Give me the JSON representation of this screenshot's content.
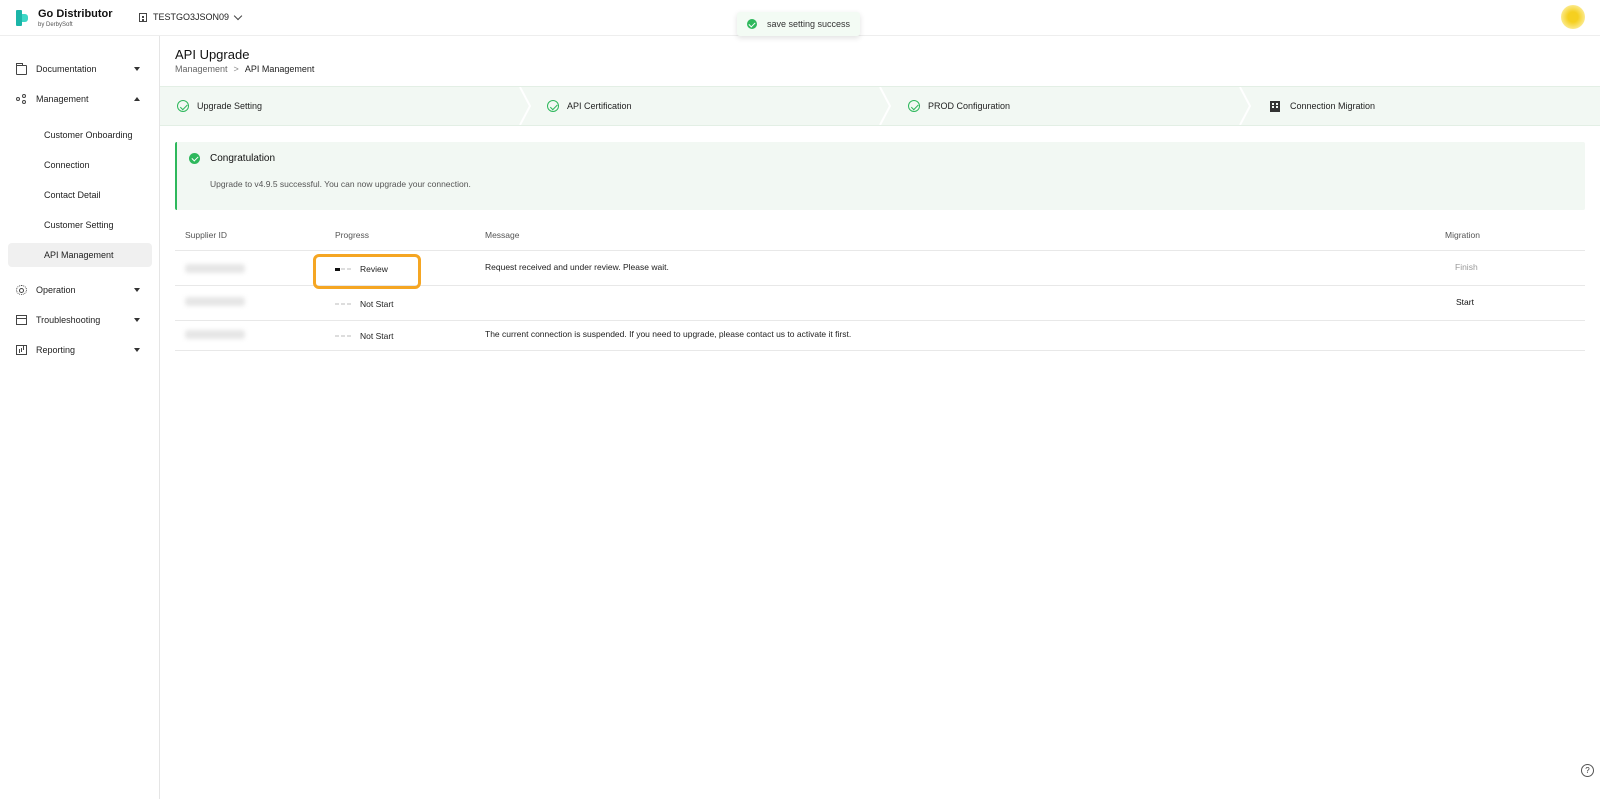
{
  "app": {
    "name": "Go Distributor",
    "by": "by DerbySoft"
  },
  "tenant": {
    "label": "TESTGO3JSON09"
  },
  "toast": {
    "message": "save setting success"
  },
  "sidebar": {
    "items": [
      {
        "label": "Documentation",
        "icon": "folder-icon"
      },
      {
        "label": "Management",
        "icon": "share-icon"
      },
      {
        "label": "Operation",
        "icon": "gear-icon"
      },
      {
        "label": "Troubleshooting",
        "icon": "calendar-icon"
      },
      {
        "label": "Reporting",
        "icon": "report-icon"
      }
    ],
    "sub_items": [
      "Customer Onboarding",
      "Connection",
      "Contact Detail",
      "Customer Setting",
      "API Management"
    ],
    "active": "API Management"
  },
  "page": {
    "title": "API Upgrade",
    "breadcrumb": [
      "Management",
      ">",
      "API Management"
    ]
  },
  "steps": [
    {
      "label": "Upgrade Setting",
      "status": "done"
    },
    {
      "label": "API Certification",
      "status": "done"
    },
    {
      "label": "PROD Configuration",
      "status": "done"
    },
    {
      "label": "Connection Migration",
      "status": "current"
    }
  ],
  "alert": {
    "title": "Congratulation",
    "message": "Upgrade to v4.9.5 successful. You can now upgrade your connection."
  },
  "table": {
    "columns": [
      "Supplier ID",
      "Progress",
      "Message",
      "Migration"
    ],
    "rows": [
      {
        "progress": "Review",
        "message": "Request received and under review. Please wait.",
        "migration": "Finish"
      },
      {
        "progress": "Not Start",
        "message": "",
        "migration": "Start"
      },
      {
        "progress": "Not Start",
        "message": "The current connection is suspended. If you need to upgrade, please contact us to activate it first.",
        "migration": ""
      }
    ]
  },
  "colors": {
    "accent": "#2eb85c",
    "highlight": "#f5a623",
    "brand": "#1bb5a8"
  }
}
